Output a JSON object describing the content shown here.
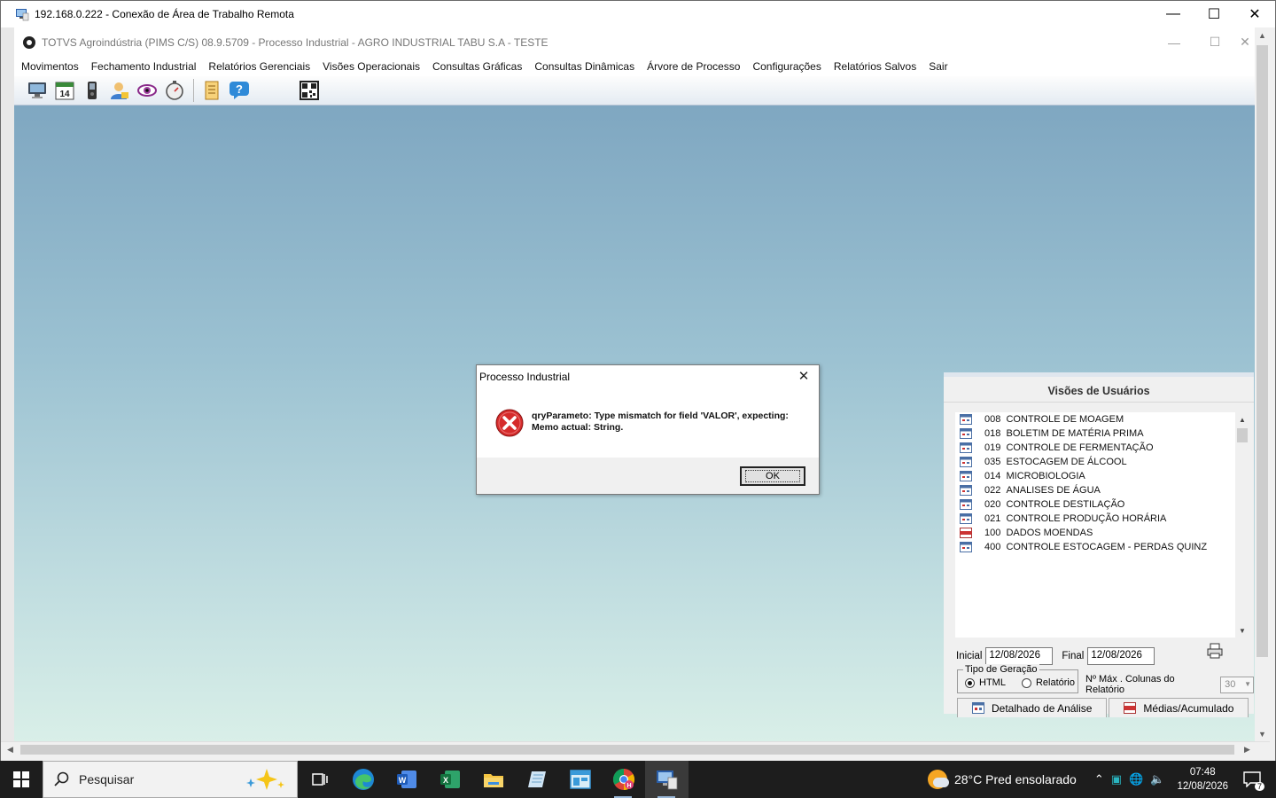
{
  "rdp": {
    "title": "192.168.0.222 - Conexão de Área de Trabalho Remota"
  },
  "app": {
    "title": "TOTVS Agroindústria (PIMS C/S) 08.9.5709 - Processo Industrial   -   AGRO INDUSTRIAL TABU S.A - TESTE",
    "menu": [
      "Movimentos",
      "Fechamento Industrial",
      "Relatórios Gerenciais",
      "Visões Operacionais",
      "Consultas Gráficas",
      "Consultas Dinâmicas",
      "Árvore de Processo",
      "Configurações",
      "Relatórios Salvos",
      "Sair"
    ],
    "toolbar_calendar_day": "14"
  },
  "dialog": {
    "title": "Processo Industrial",
    "message": "qryParameto: Type mismatch for field 'VALOR', expecting:\nMemo actual: String.",
    "ok_label": "OK"
  },
  "visoes": {
    "title": "Visões de Usuários",
    "items": [
      {
        "code": "008",
        "name": "CONTROLE DE MOAGEM"
      },
      {
        "code": "018",
        "name": "BOLETIM DE MATÉRIA PRIMA"
      },
      {
        "code": "019",
        "name": "CONTROLE DE FERMENTAÇÃO"
      },
      {
        "code": "035",
        "name": "ESTOCAGEM DE ÁLCOOL"
      },
      {
        "code": "014",
        "name": "MICROBIOLOGIA"
      },
      {
        "code": "022",
        "name": "ANALISES DE ÁGUA"
      },
      {
        "code": "020",
        "name": "CONTROLE DESTILAÇÃO"
      },
      {
        "code": "021",
        "name": "CONTROLE PRODUÇÃO HORÁRIA"
      },
      {
        "code": "100",
        "name": "DADOS MOENDAS"
      },
      {
        "code": "400",
        "name": "CONTROLE ESTOCAGEM - PERDAS QUINZ"
      }
    ],
    "inicial_label": "Inicial",
    "inicial_value": "12/08/2026",
    "final_label": "Final",
    "final_value": "12/08/2026",
    "tipo_label": "Tipo de Geração",
    "html_label": "HTML",
    "relatorio_label": "Relatório",
    "maxcol_label": "Nº Máx . Colunas do Relatório",
    "maxcol_value": "30",
    "tab1": "Detalhado de Análise",
    "tab2": "Médias/Acumulado"
  },
  "taskbar": {
    "search_placeholder": "Pesquisar",
    "weather": "28°C  Pred ensolarado",
    "time": "07:48",
    "date": "12/08/2026",
    "notif_count": "7"
  }
}
